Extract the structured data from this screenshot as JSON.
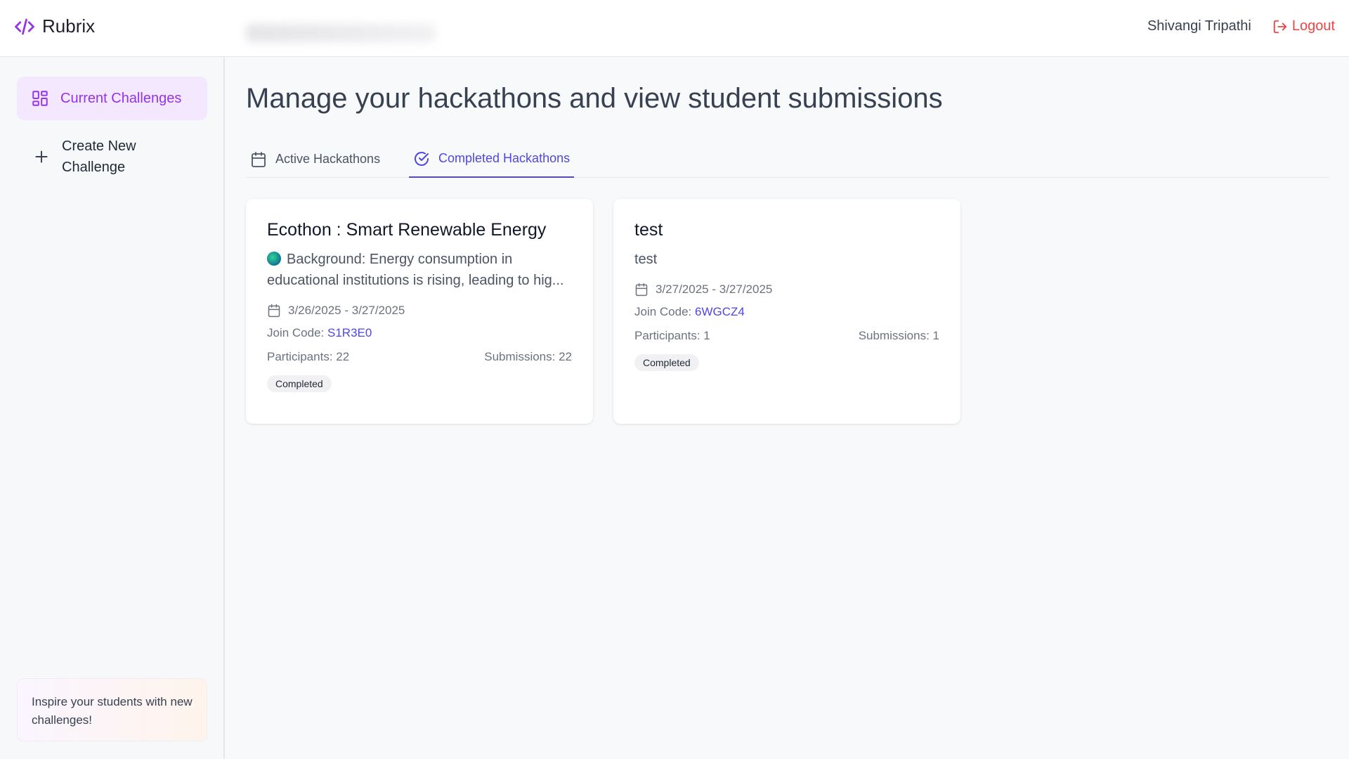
{
  "app": {
    "name": "Rubrix",
    "logo_icon": "code-icon",
    "accent_color": "#9333ea"
  },
  "header": {
    "user_name": "Shivangi Tripathi",
    "logout_label": "Logout"
  },
  "sidebar": {
    "items": [
      {
        "label": "Current Challenges",
        "icon": "grid-icon",
        "active": true
      },
      {
        "label": "Create New Challenge",
        "icon": "plus-icon",
        "active": false
      }
    ],
    "inspire_text": "Inspire your students with new challenges!"
  },
  "main": {
    "title": "Manage your hackathons and view student submissions",
    "tabs": [
      {
        "label": "Active Hackathons",
        "icon": "calendar-icon",
        "active": false
      },
      {
        "label": "Completed Hackathons",
        "icon": "check-circle-icon",
        "active": true
      }
    ],
    "cards": [
      {
        "title": "Ecothon : Smart Renewable Energy",
        "description": "Background: Energy consumption in educational institutions is rising, leading to hig...",
        "description_icon": "globe-emoji",
        "dates": "3/26/2025 - 3/27/2025",
        "join_code_label": "Join Code:",
        "join_code": "S1R3E0",
        "participants": "Participants: 22",
        "submissions": "Submissions: 22",
        "status": "Completed"
      },
      {
        "title": "test",
        "description": "test",
        "dates": "3/27/2025 - 3/27/2025",
        "join_code_label": "Join Code:",
        "join_code": "6WGCZ4",
        "participants": "Participants: 1",
        "submissions": "Submissions: 1",
        "status": "Completed"
      }
    ]
  }
}
